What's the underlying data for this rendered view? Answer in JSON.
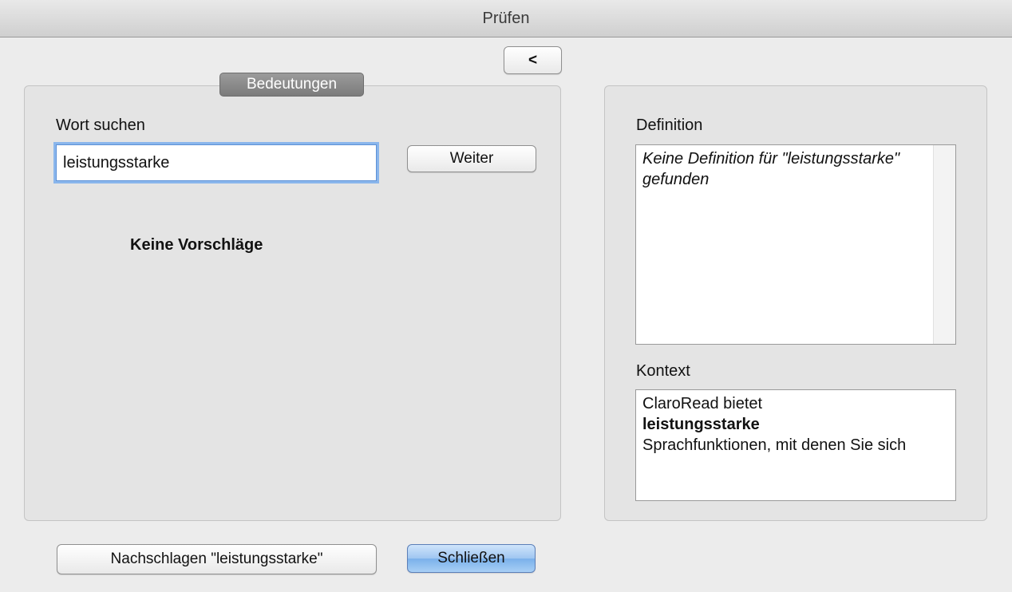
{
  "window": {
    "title": "Prüfen"
  },
  "toolbar": {
    "back_label": "<"
  },
  "meanings_panel": {
    "tab_label": "Bedeutungen",
    "search_label": "Wort suchen",
    "search_value": "leistungsstarke",
    "next_label": "Weiter",
    "no_suggestions": "Keine Vorschläge"
  },
  "info_panel": {
    "definition_label": "Definition",
    "definition_text": "Keine Definition für \"leistungsstarke\" gefunden",
    "context_label": "Kontext",
    "context_before": "ClaroRead bietet",
    "context_word": "leistungsstarke",
    "context_after": "Sprachfunktionen, mit denen Sie sich"
  },
  "footer": {
    "lookup_label": "Nachschlagen \"leistungsstarke\"",
    "close_label": "Schließen"
  },
  "colors": {
    "window_bg": "#ececec",
    "panel_bg": "#e4e4e4",
    "tab_bg": "#8a8a8a",
    "focus_ring": "#8ab6ec",
    "default_button": "#9fc6f1"
  }
}
